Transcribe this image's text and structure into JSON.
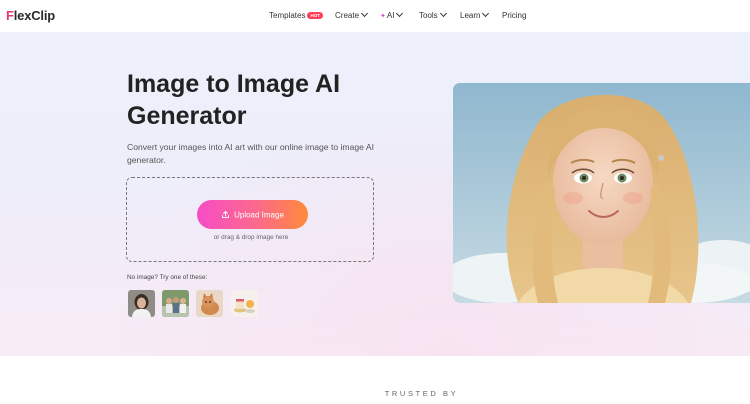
{
  "brand": {
    "name_first": "F",
    "name_rest": "lexClip"
  },
  "nav": {
    "templates": "Templates",
    "templates_badge": "HOT",
    "create": "Create",
    "ai": "AI",
    "tools": "Tools",
    "learn": "Learn",
    "pricing": "Pricing"
  },
  "hero": {
    "title": "Image to Image AI Generator",
    "description": "Convert your images into AI art with our online image to image AI generator.",
    "upload_label": "Upload Image",
    "drop_hint": "or drag & drop image here",
    "try_label": "No image? Try one of these:"
  },
  "trusted": "TRUSTED BY",
  "colors": {
    "accent_start": "#f74cc6",
    "accent_end": "#ff8a3a",
    "hot_badge": "#ff3d57",
    "logo_accent": "#e23d6d"
  }
}
